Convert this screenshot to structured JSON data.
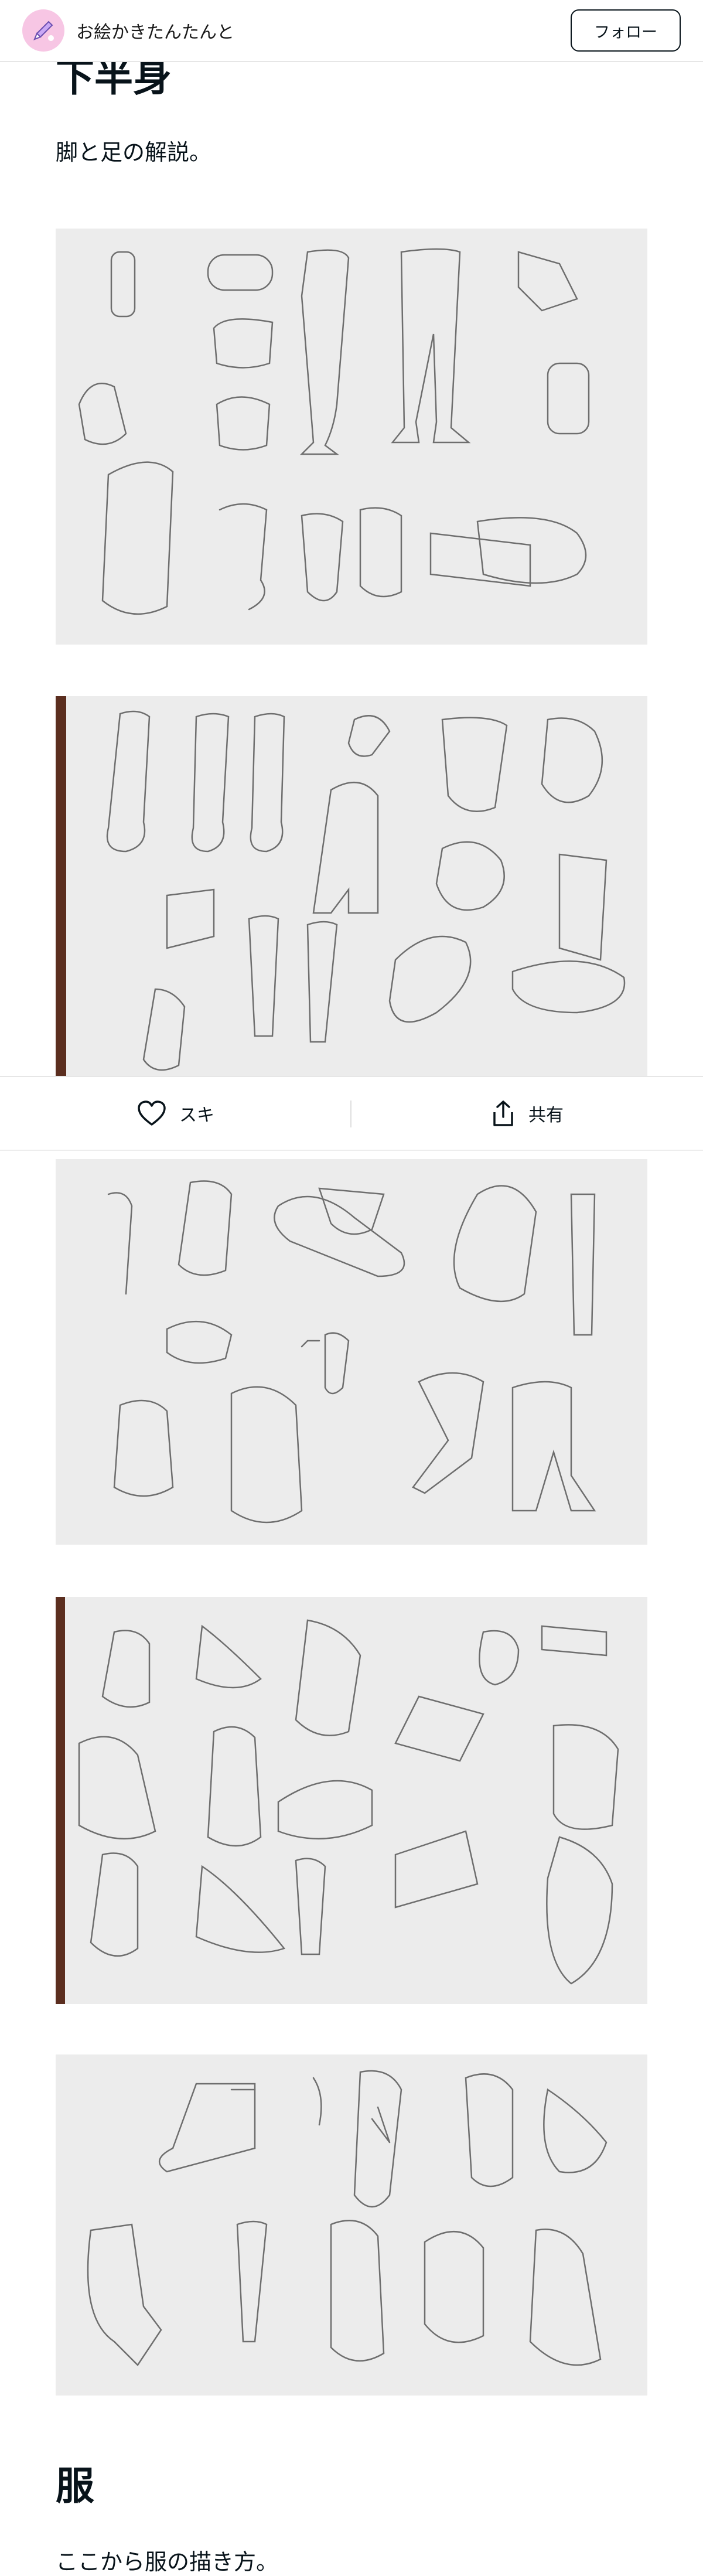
{
  "header": {
    "site_name": "お絵かきたんたんと",
    "follow_label": "フォロー"
  },
  "section1": {
    "heading": "下半身",
    "description": "脚と足の解説。"
  },
  "actions": {
    "like_label": "スキ",
    "share_label": "共有"
  },
  "section2": {
    "heading": "服",
    "description": "ここから服の描き方。"
  },
  "icons": {
    "avatar": "pencil-icon",
    "like": "heart-icon",
    "share": "share-icon"
  },
  "colors": {
    "accent": "#f7c6e4",
    "text": "#08131a"
  }
}
